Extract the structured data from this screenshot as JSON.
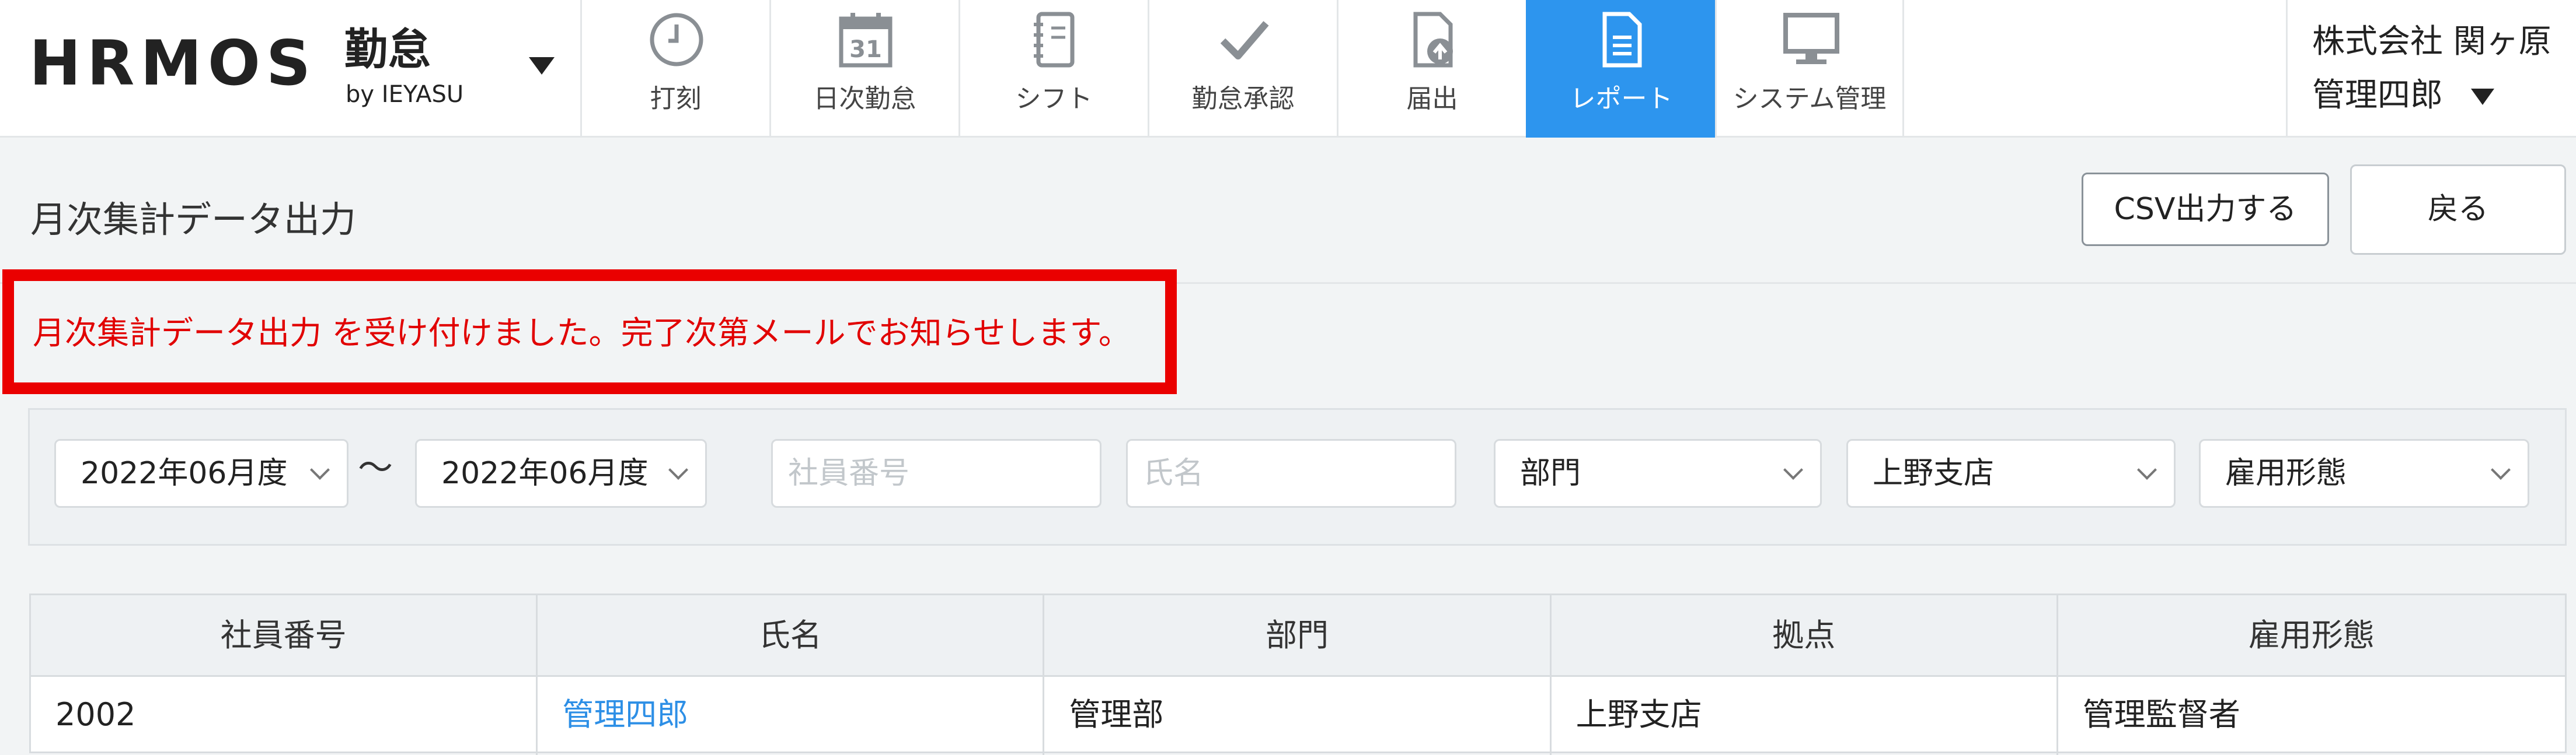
{
  "header": {
    "logo": "HRMOS",
    "product": "勤怠",
    "vendor": "by IEYASU",
    "nav": [
      {
        "label": "打刻",
        "icon": "clock-icon",
        "active": false
      },
      {
        "label": "日次勤怠",
        "icon": "calendar-31-icon",
        "calendar_day": "31",
        "active": false
      },
      {
        "label": "シフト",
        "icon": "notebook-icon",
        "active": false
      },
      {
        "label": "勤怠承認",
        "icon": "checkmark-icon",
        "active": false
      },
      {
        "label": "届出",
        "icon": "document-upload-icon",
        "active": false
      },
      {
        "label": "レポート",
        "icon": "report-document-icon",
        "active": true
      },
      {
        "label": "システム管理",
        "icon": "monitor-icon",
        "active": false
      }
    ],
    "company": "株式会社 関ヶ原",
    "user": "管理四郎"
  },
  "page": {
    "title": "月次集計データ出力",
    "csv_button": "CSV出力する",
    "back_button": "戻る"
  },
  "notice": {
    "message": "月次集計データ出力 を受け付けました。完了次第メールでお知らせします。"
  },
  "filters": {
    "from_period": "2022年06月度",
    "separator": "〜",
    "to_period": "2022年06月度",
    "employee_number_placeholder": "社員番号",
    "name_placeholder": "氏名",
    "department": "部門",
    "location": "上野支店",
    "employment_type": "雇用形態"
  },
  "table": {
    "columns": [
      "社員番号",
      "氏名",
      "部門",
      "拠点",
      "雇用形態"
    ],
    "rows": [
      [
        "2002",
        "管理四郎",
        "管理部",
        "上野支店",
        "管理監督者"
      ]
    ]
  },
  "colors": {
    "accent": "#2d95ee",
    "notice_red": "#e10000",
    "link": "#2d8fe6"
  }
}
